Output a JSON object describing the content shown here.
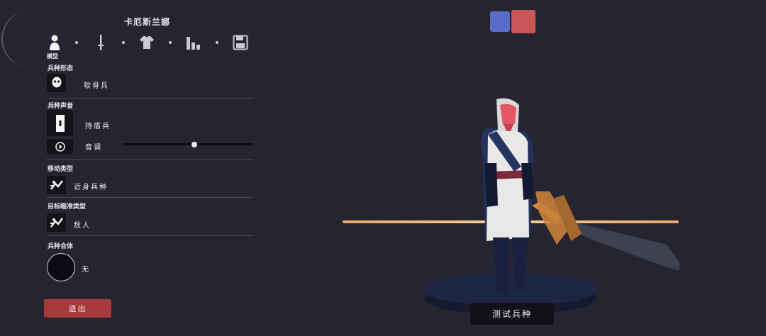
{
  "unit_name": "卡厄斯兰娜",
  "tabs": {
    "model_label": "模型",
    "icons": [
      "person-icon",
      "sword-icon",
      "shirt-icon",
      "stats-icon",
      "save-icon"
    ]
  },
  "sections": {
    "unit_form": {
      "label": "兵种形态",
      "value": "软骨兵"
    },
    "unit_voice": {
      "label": "兵种声音",
      "value": "持盾兵",
      "pitch_label": "音调",
      "pitch_level": 0.55
    },
    "movement_type": {
      "label": "移动类型",
      "value": "近身兵种"
    },
    "target_type": {
      "label": "目标瞄准类型",
      "value": "敌人"
    },
    "unit_combo": {
      "label": "兵种合体",
      "value": "无"
    }
  },
  "buttons": {
    "exit": "退出",
    "test_unit": "测试兵种"
  },
  "teams": {
    "blue": "#5a6bc8",
    "red": "#c85656"
  },
  "colors": {
    "accent_red": "#a63a3a",
    "stage_line": "#f3c68a"
  }
}
